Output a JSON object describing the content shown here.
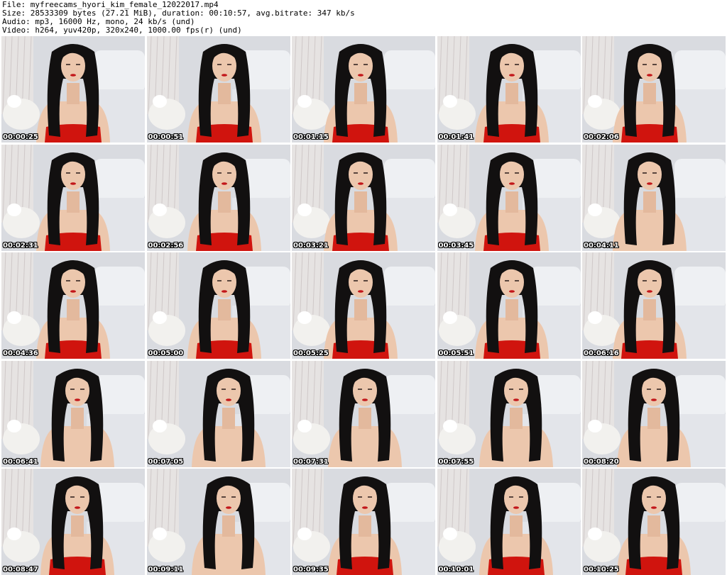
{
  "header": {
    "file": "File: myfreecams_hyori_kim_female_12022017.mp4",
    "size": "Size: 28533309 bytes (27.21 MiB), duration: 00:10:57, avg.bitrate: 347 kb/s",
    "audio": "Audio: mp3, 16000 Hz, mono, 24 kb/s (und)",
    "video": "Video: h264, yuv420p, 320x240, 1000.00 fps(r) (und)"
  },
  "thumbnails": [
    {
      "time": "00:00:25",
      "dress": "red"
    },
    {
      "time": "00:00:51",
      "dress": "red"
    },
    {
      "time": "00:01:15",
      "dress": "red"
    },
    {
      "time": "00:01:41",
      "dress": "red"
    },
    {
      "time": "00:02:06",
      "dress": "red"
    },
    {
      "time": "00:02:31",
      "dress": "red"
    },
    {
      "time": "00:02:56",
      "dress": "red"
    },
    {
      "time": "00:03:21",
      "dress": "red"
    },
    {
      "time": "00:03:45",
      "dress": "red"
    },
    {
      "time": "00:04:11",
      "dress": "none"
    },
    {
      "time": "00:04:36",
      "dress": "red"
    },
    {
      "time": "00:05:00",
      "dress": "red"
    },
    {
      "time": "00:05:25",
      "dress": "red"
    },
    {
      "time": "00:05:51",
      "dress": "red"
    },
    {
      "time": "00:06:16",
      "dress": "red"
    },
    {
      "time": "00:06:41",
      "dress": "none"
    },
    {
      "time": "00:07:05",
      "dress": "none"
    },
    {
      "time": "00:07:31",
      "dress": "none"
    },
    {
      "time": "00:07:55",
      "dress": "none"
    },
    {
      "time": "00:08:20",
      "dress": "none"
    },
    {
      "time": "00:08:47",
      "dress": "red"
    },
    {
      "time": "00:09:11",
      "dress": "none"
    },
    {
      "time": "00:09:35",
      "dress": "red"
    },
    {
      "time": "00:10:01",
      "dress": "red"
    },
    {
      "time": "00:10:25",
      "dress": "red"
    }
  ],
  "colors": {
    "background": "#d9dbe0",
    "skin": "#ecc7ad",
    "hair": "#121010",
    "dress": "#d0140e",
    "pillow": "#f2f1ee"
  }
}
